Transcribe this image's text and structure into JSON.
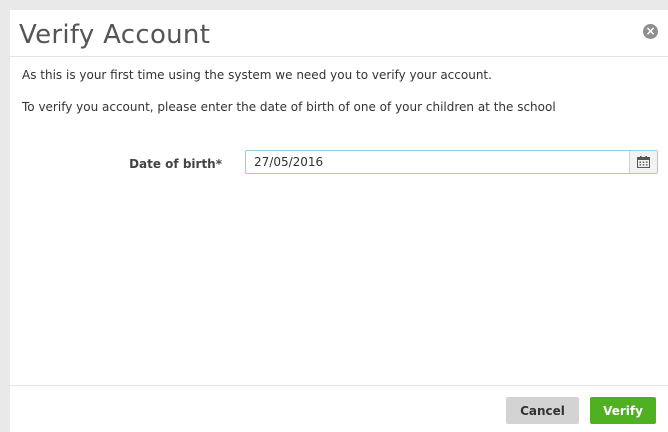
{
  "modal": {
    "title": "Verify Account",
    "close_icon": "close-icon"
  },
  "body": {
    "intro_line1": "As this is your first time using the system we need you to verify your account.",
    "intro_line2": "To verify you account, please enter the date of birth of one of your children at the school",
    "dob_label": "Date of birth*",
    "dob_value": "27/05/2016",
    "calendar_icon": "calendar-icon"
  },
  "footer": {
    "cancel_label": "Cancel",
    "verify_label": "Verify"
  },
  "colors": {
    "verify_button": "#4fb021",
    "cancel_button": "#d3d3d3",
    "input_focus_border": "#8fd3e3"
  }
}
